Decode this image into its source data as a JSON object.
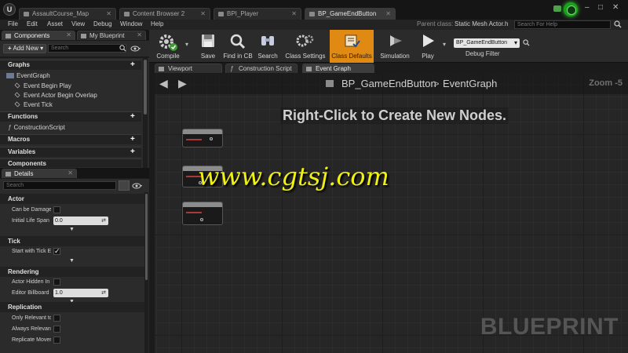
{
  "window": {
    "doc_tabs": [
      {
        "label": "AssaultCourse_Map",
        "active": false
      },
      {
        "label": "Content Browser 2",
        "active": false
      },
      {
        "label": "BPI_Player",
        "active": false
      },
      {
        "label": "BP_GameEndButton",
        "active": true
      }
    ],
    "controls": {
      "minimize": "–",
      "maximize": "□",
      "close": "✕"
    }
  },
  "menu": {
    "items": [
      "File",
      "Edit",
      "Asset",
      "View",
      "Debug",
      "Window",
      "Help"
    ],
    "parent_class_label": "Parent class:",
    "parent_class_value": "Static Mesh Actor.h",
    "help_search_placeholder": "Search For Help"
  },
  "left_tabs": [
    {
      "label": "Components",
      "active": true
    },
    {
      "label": "My Blueprint",
      "active": false
    }
  ],
  "components": {
    "add_new_label": "Add New ▾",
    "search_placeholder": "Search"
  },
  "my_blueprint": {
    "graphs_header": "Graphs",
    "event_graph": "EventGraph",
    "events": [
      "Event Begin Play",
      "Event Actor Begin Overlap",
      "Event Tick"
    ],
    "functions_header": "Functions",
    "construction_script": "ConstructionScript",
    "macros_header": "Macros",
    "variables_header": "Variables",
    "components_header": "Components"
  },
  "details": {
    "tab_label": "Details",
    "search_placeholder": "Search",
    "sections": {
      "actor": "Actor",
      "tick": "Tick",
      "rendering": "Rendering",
      "replication": "Replication"
    },
    "props": {
      "can_be_damaged": "Can be Damaged",
      "initial_life_span": "Initial Life Span",
      "initial_life_span_value": "0.0",
      "start_with_tick": "Start with Tick Enabled",
      "start_with_tick_checked": true,
      "actor_hidden": "Actor Hidden In Game",
      "editor_billboard": "Editor Billboard Scale",
      "editor_billboard_value": "1.0",
      "only_relevant": "Only Relevant to Owner",
      "always_relevant": "Always Relevant",
      "replicate_movement": "Replicate Movement"
    }
  },
  "toolbar": {
    "buttons": [
      {
        "label": "Compile",
        "icon": "compile-gear-icon"
      },
      {
        "label": "Save",
        "icon": "save-disk-icon"
      },
      {
        "label": "Find in CB",
        "icon": "find-in-cb-icon"
      },
      {
        "label": "Search",
        "icon": "binoculars-icon"
      },
      {
        "label": "Class Settings",
        "icon": "class-settings-icon"
      },
      {
        "label": "Class Defaults",
        "icon": "class-defaults-icon",
        "highlighted": true
      },
      {
        "label": "Simulation",
        "icon": "simulation-icon"
      },
      {
        "label": "Play",
        "icon": "play-icon"
      }
    ],
    "debug_object": "BP_GameEndButton",
    "debug_filter_label": "Debug Filter"
  },
  "editor_tabs": [
    {
      "label": "Viewport",
      "active": false
    },
    {
      "label": "Construction Script",
      "active": false
    },
    {
      "label": "Event Graph",
      "active": true
    }
  ],
  "graph": {
    "blueprint_name": "BP_GameEndButton",
    "separator": ">",
    "graph_name": "EventGraph",
    "zoom": "Zoom -5",
    "hint": "Right-Click to Create New Nodes.",
    "watermark": "BLUEPRINT"
  },
  "overlay_watermark": "www.cgtsj.com",
  "colors": {
    "accent_orange": "#e08a14",
    "watermark_yellow": "#f0f012",
    "notification_green": "#18a11b"
  }
}
